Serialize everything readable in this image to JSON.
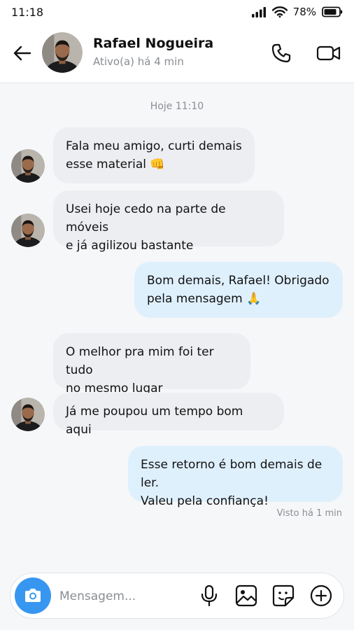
{
  "status_bar": {
    "time": "11:18",
    "battery": "78%"
  },
  "header": {
    "name": "Rafael Nogueira",
    "status": "Ativo(a) há 4 min"
  },
  "chat": {
    "date_separator": "Hoje 11:10",
    "messages": [
      {
        "direction": "in",
        "text": "Fala meu amigo, curti demais\nesse material 👊"
      },
      {
        "direction": "in",
        "text": "Usei hoje cedo na parte de móveis\ne já agilizou bastante"
      },
      {
        "direction": "out",
        "text": "Bom demais, Rafael! Obrigado\npela mensagem 🙏"
      },
      {
        "direction": "in",
        "text": "O melhor pra mim foi ter tudo\nno mesmo lugar"
      },
      {
        "direction": "in",
        "text": "Já me poupou um tempo bom aqui"
      },
      {
        "direction": "out",
        "text": "Esse retorno é bom demais de ler.\nValeu pela confiança!"
      }
    ],
    "seen": "Visto há 1 min"
  },
  "composer": {
    "placeholder": "Mensagem..."
  },
  "icons": {
    "back": "arrow-left-icon",
    "call": "phone-icon",
    "video": "video-camera-icon",
    "camera": "camera-icon",
    "mic": "microphone-icon",
    "gallery": "image-icon",
    "sticker": "sticker-icon",
    "more": "plus-circle-icon"
  },
  "colors": {
    "accent": "#3797f0",
    "incoming_bubble": "#eceef1",
    "outgoing_bubble": "#dff0fd"
  }
}
